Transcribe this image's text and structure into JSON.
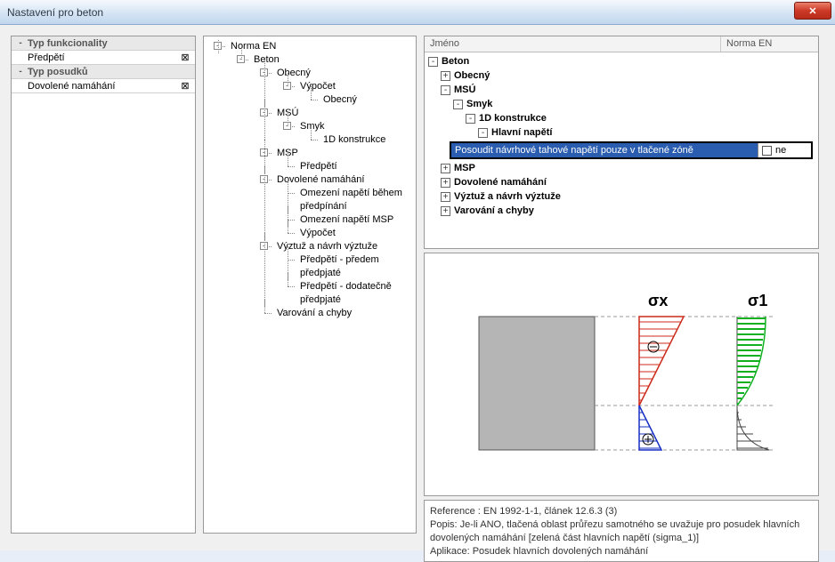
{
  "window": {
    "title": "Nastavení pro beton"
  },
  "left_panel": {
    "rows": [
      {
        "toggle": "-",
        "label": "Typ funkcionality",
        "header": true
      },
      {
        "toggle": "",
        "label": "Předpětí",
        "check": "⊠"
      },
      {
        "toggle": "-",
        "label": "Typ posudků",
        "header": true
      },
      {
        "toggle": "",
        "label": "Dovolené namáhání",
        "check": "⊠"
      }
    ]
  },
  "tree": {
    "root": "Norma EN",
    "beton": "Beton",
    "obecny": "Obecný",
    "vypocet": "Výpočet",
    "obecny2": "Obecný",
    "msu": "MSÚ",
    "smyk": "Smyk",
    "d1": "1D konstrukce",
    "msp": "MSP",
    "predpeti": "Předpětí",
    "dovol": "Dovolené namáhání",
    "omez1": "Omezení napětí během předpínání",
    "omez2": "Omezení napětí MSP",
    "vypocet2": "Výpočet",
    "vyztuz": "Výztuž a návrh výztuže",
    "pp1": "Předpětí - předem předpjaté",
    "pp2": "Předpětí - dodatečně předpjaté",
    "varov": "Varování a chyby"
  },
  "prop_grid": {
    "head_name": "Jméno",
    "head_norm": "Norma EN",
    "rows": [
      {
        "toggle": "-",
        "indent": 0,
        "label": "Beton"
      },
      {
        "toggle": "+",
        "indent": 1,
        "label": "Obecný"
      },
      {
        "toggle": "-",
        "indent": 1,
        "label": "MSÚ"
      },
      {
        "toggle": "-",
        "indent": 2,
        "label": "Smyk"
      },
      {
        "toggle": "-",
        "indent": 3,
        "label": "1D konstrukce"
      },
      {
        "toggle": "-",
        "indent": 4,
        "label": "Hlavní napětí"
      }
    ],
    "selected": {
      "label": "Posoudit návrhové tahové napětí pouze v tlačené zóně",
      "value": "ne"
    },
    "rows_after": [
      {
        "toggle": "+",
        "indent": 1,
        "label": "MSP"
      },
      {
        "toggle": "+",
        "indent": 1,
        "label": "Dovolené namáhání"
      },
      {
        "toggle": "+",
        "indent": 1,
        "label": "Výztuž a návrh výztuže"
      },
      {
        "toggle": "+",
        "indent": 1,
        "label": "Varování a chyby"
      }
    ]
  },
  "diagram": {
    "sigma_x": "σx",
    "sigma_1": "σ1"
  },
  "description": {
    "l1": "Reference :  EN 1992-1-1, článek 12.6.3 (3)",
    "l2": "Popis:  Je-li ANO, tlačená oblast průřezu samotného se uvažuje pro posudek hlavních dovolených namáhání [zelená část hlavních napětí (sigma_1)]",
    "l3": "Aplikace:  Posudek hlavních dovolených namáhání"
  }
}
